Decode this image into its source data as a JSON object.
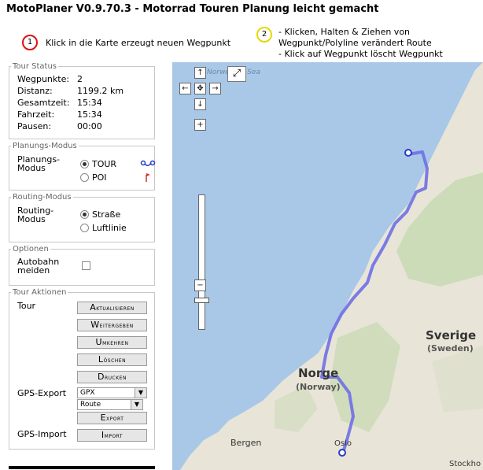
{
  "header": {
    "title": "MotoPlaner V0.9.70.3 - Motorrad Touren Planung leicht gemacht",
    "hint1_number": "1",
    "hint1_text": "Klick in die Karte erzeugt neuen Wegpunkt",
    "hint2_number": "2",
    "hint2_line1": "- Klicken, Halten & Ziehen von",
    "hint2_line2": "Wegpunkt/Polyline verändert Route",
    "hint2_line3": "- Klick auf Wegpunkt löscht Wegpunkt"
  },
  "tour_status": {
    "legend": "Tour Status",
    "rows": [
      {
        "label": "Wegpunkte:",
        "value": "2"
      },
      {
        "label": "Distanz:",
        "value": "1199.2 km"
      },
      {
        "label": "Gesamtzeit:",
        "value": "15:34"
      },
      {
        "label": "Fahrzeit:",
        "value": "15:34"
      },
      {
        "label": "Pausen:",
        "value": "00:00"
      }
    ]
  },
  "planning_mode": {
    "legend": "Planungs-Modus",
    "label_line1": "Planungs-",
    "label_line2": "Modus",
    "option_tour": "TOUR",
    "option_poi": "POI",
    "selected": "TOUR"
  },
  "routing_mode": {
    "legend": "Routing-Modus",
    "label_line1": "Routing-",
    "label_line2": "Modus",
    "option_road": "Straße",
    "option_line": "Luftlinie",
    "selected": "Straße"
  },
  "options": {
    "legend": "Optionen",
    "label_line1": "Autobahn",
    "label_line2": "meiden",
    "avoid_highway_checked": false
  },
  "tour_actions": {
    "legend": "Tour Aktionen",
    "tour_label": "Tour",
    "buttons": [
      "Aktualisieren",
      "Weitergeben",
      "Umkehren",
      "Löschen",
      "Drucken"
    ],
    "gps_export_label": "GPS-Export",
    "format_select": "GPX",
    "type_select": "Route",
    "export_button": "Export",
    "gps_import_label": "GPS-Import",
    "import_button": "Import"
  },
  "map": {
    "labels": {
      "sverige": "Sverige",
      "sweden": "(Sweden)",
      "norge": "Norge",
      "norway": "(Norway)",
      "bergen": "Bergen",
      "oslo": "Oslo",
      "stockholm": "Stockho",
      "sea": "Norwegian Sea"
    },
    "controls": {
      "pan_up": "↑",
      "pan_left": "←",
      "pan_center": "✥",
      "pan_right": "→",
      "pan_down": "↓",
      "zoom_in": "+",
      "zoom_out": "−",
      "fullscreen": "⤢"
    },
    "colors": {
      "water": "#a9c8e8",
      "land": "#e8e5d8",
      "forest": "#c6d9b0",
      "route": "#6f6fe6",
      "waypoint": "#2a3cc8"
    }
  }
}
